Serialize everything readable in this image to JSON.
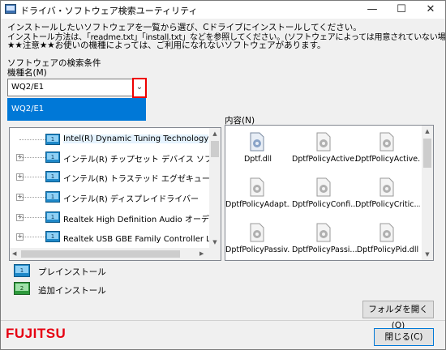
{
  "window": {
    "title": "ドライバ・ソフトウェア検索ユーティリティ",
    "minimize": "—",
    "maximize": "☐",
    "close": "✕"
  },
  "intro": {
    "line1": "インストールしたいソフトウェアを一覧から選び、Cドライブにインストールしてください。",
    "line2": "インストール方法は、「readme.txt」「install.txt」などを参照してください。(ソフトウェアによっては用意されていない場合もあります)",
    "line3": "★★注意★★お使いの機種によっては、ご利用になれないソフトウェアがあります。"
  },
  "search": {
    "group_label": "ソフトウェアの検索条件",
    "model_label": "機種名(M)",
    "selected": "WQ2/E1",
    "options": [
      "WQ2/E1"
    ]
  },
  "tree": {
    "items": [
      {
        "label": "Intel(R) Dynamic Tuning Technology",
        "expander": ""
      },
      {
        "label": "インテル(R) チップセット デバイス ソフトウェア",
        "expander": "+"
      },
      {
        "label": "インテル(R) トラステッド エグゼキューション エンジ",
        "expander": "+"
      },
      {
        "label": "インテル(R) ディスプレイドライバー",
        "expander": "+"
      },
      {
        "label": "Realtek High Definition Audio オーディオドライバ",
        "expander": "+"
      },
      {
        "label": "Realtek USB GBE Family Controller LANドライバ",
        "expander": "+"
      }
    ]
  },
  "contents": {
    "label": "内容(N)",
    "files": [
      "Dptf.dll",
      "DptfPolicyActive...",
      "DptfPolicyActive...",
      "DptfPolicyAdapt...",
      "DptfPolicyConfi...",
      "DptfPolicyCritic...",
      "DptfPolicyPassiv...",
      "DptfPolicyPassi...",
      "DptfPolicyPid.dll"
    ]
  },
  "legend": {
    "preinstall": "プレインストール",
    "additional": "追加インストール"
  },
  "buttons": {
    "open_folder": "フォルダを開く(O)",
    "close": "閉じる(C)"
  },
  "brand": {
    "logo": "FUJITSU",
    "color": "#e60012"
  },
  "colors": {
    "accent": "#0078d7"
  }
}
